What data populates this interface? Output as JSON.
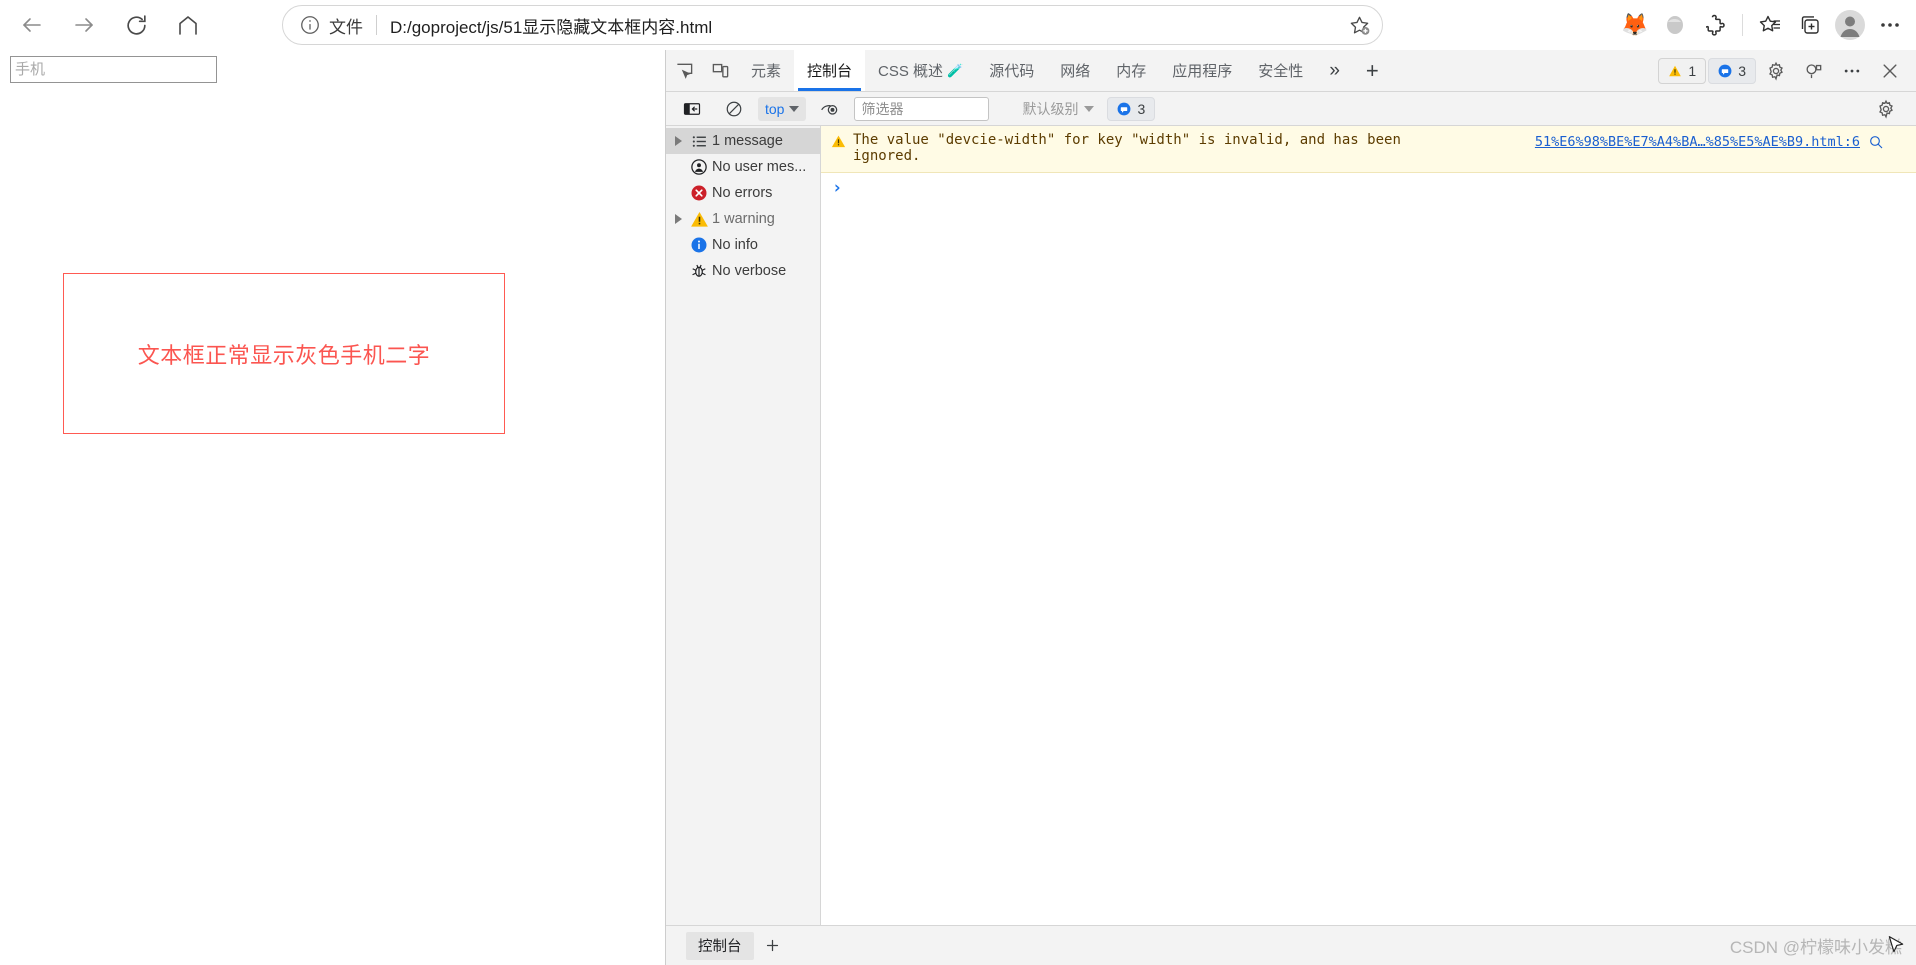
{
  "browser": {
    "nav": {
      "back_label": "Back",
      "forward_label": "Forward",
      "reload_label": "Refresh",
      "home_label": "Home"
    },
    "omnibox": {
      "scheme_label": "文件",
      "url": "D:/goproject/js/51显示隐藏文本框内容.html",
      "favorite_label": "Add to favorites"
    },
    "toolbar_icons": [
      {
        "name": "extension-fox-icon",
        "glyph": "🦊"
      },
      {
        "name": "extension-wallet-icon",
        "glyph": "🔮"
      },
      {
        "name": "extensions-puzzle-icon",
        "glyph": ""
      },
      {
        "name": "favorites-list-icon",
        "glyph": ""
      },
      {
        "name": "collections-icon",
        "glyph": ""
      },
      {
        "name": "profile-avatar-icon",
        "glyph": ""
      },
      {
        "name": "settings-more-icon",
        "glyph": ""
      }
    ]
  },
  "page": {
    "phone_input": {
      "value": "",
      "placeholder": "手机"
    },
    "red_box_text": "文本框正常显示灰色手机二字",
    "red_box_border_color": "#ff5a52",
    "red_box_text_color": "#fb5550"
  },
  "devtools": {
    "tabs": [
      {
        "label": "元素",
        "active": false
      },
      {
        "label": "控制台",
        "active": true
      },
      {
        "label": "CSS 概述",
        "active": false,
        "suffix": "🧪"
      },
      {
        "label": "源代码",
        "active": false
      },
      {
        "label": "网络",
        "active": false
      },
      {
        "label": "内存",
        "active": false
      },
      {
        "label": "应用程序",
        "active": false
      },
      {
        "label": "安全性",
        "active": false
      }
    ],
    "more_tabs_label": "»",
    "add_tab_label": "+",
    "badges": {
      "warning_count": "1",
      "message_count": "3"
    },
    "accent_color": "#1a73e8",
    "console_toolbar": {
      "context_value": "top",
      "filter_placeholder": "筛选器",
      "filter_value": "",
      "level_label": "默认级别",
      "level_count": "3"
    },
    "sidebar": [
      {
        "label": "1 message",
        "icon": "list-icon",
        "selected": true,
        "expandable": true,
        "dim": false
      },
      {
        "label": "No user mes...",
        "icon": "user-message-icon",
        "selected": false,
        "expandable": false,
        "dim": false
      },
      {
        "label": "No errors",
        "icon": "error-icon",
        "selected": false,
        "expandable": false,
        "dim": false
      },
      {
        "label": "1 warning",
        "icon": "warning-icon",
        "selected": false,
        "expandable": true,
        "dim": true
      },
      {
        "label": "No info",
        "icon": "info-icon",
        "selected": false,
        "expandable": false,
        "dim": false
      },
      {
        "label": "No verbose",
        "icon": "bug-icon",
        "selected": false,
        "expandable": false,
        "dim": false
      }
    ],
    "console_message": {
      "level": "warning",
      "text": "The value \"devcie-width\" for key \"width\" is invalid, and has been ignored.",
      "source_link": "51%E6%98%BE%E7%A4%BA…%85%E5%AE%B9.html:6",
      "background_color": "#fffbe5"
    },
    "prompt_caret": "›",
    "drawer": {
      "tab_label": "控制台",
      "add_label": "+"
    }
  },
  "watermark": "CSDN @柠檬味小发糕"
}
